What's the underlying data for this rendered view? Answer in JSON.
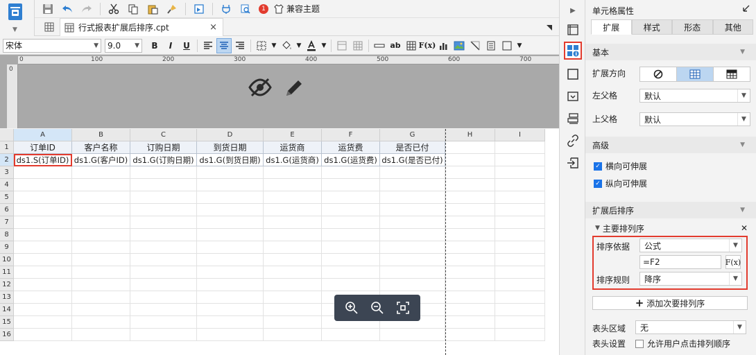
{
  "app": {
    "logo_icon": "report-logo-icon"
  },
  "toolbar": {
    "badge_count": "1",
    "compat_theme_label": "兼容主题"
  },
  "tab": {
    "title": "行式报表扩展后排序.cpt",
    "close": "×"
  },
  "format": {
    "font_family": "宋体",
    "font_size": "9.0",
    "bold": "B",
    "italic": "I",
    "underline": "U",
    "text_tool": "ab",
    "fx": "F(x)"
  },
  "ruler": {
    "ticks": [
      "0",
      "100",
      "200",
      "300",
      "400",
      "500",
      "600",
      "700"
    ]
  },
  "grid": {
    "columns": [
      "A",
      "B",
      "C",
      "D",
      "E",
      "F",
      "G",
      "H",
      "I"
    ],
    "rows": [
      "1",
      "2",
      "3",
      "4",
      "5",
      "6",
      "7",
      "8",
      "9",
      "10",
      "11",
      "12",
      "13",
      "14",
      "15",
      "16"
    ],
    "header_row": [
      "订单ID",
      "客户名称",
      "订购日期",
      "到货日期",
      "运货商",
      "运货费",
      "是否已付"
    ],
    "data_row": [
      "ds1.S(订单ID)",
      "ds1.G(客户ID)",
      "ds1.G(订购日期)",
      "ds1.G(到货日期)",
      "ds1.G(运货商)",
      "ds1.G(运货费)",
      "ds1.G(是否已付)"
    ]
  },
  "panel": {
    "title": "单元格属性",
    "tabs": [
      "扩展",
      "样式",
      "形态",
      "其他"
    ],
    "basic": {
      "section": "基本",
      "expand_direction_label": "扩展方向",
      "left_parent_label": "左父格",
      "left_parent_value": "默认",
      "top_parent_label": "上父格",
      "top_parent_value": "默认"
    },
    "advanced": {
      "section": "高级",
      "horizontal_expand": "横向可伸展",
      "vertical_expand": "纵向可伸展"
    },
    "sort": {
      "section": "扩展后排序",
      "primary_title": "主要排列序",
      "basis_label": "排序依据",
      "basis_value": "公式",
      "formula_value": "=F2",
      "fx_label": "F(x)",
      "rule_label": "排序规则",
      "rule_value": "降序",
      "add_secondary": "添加次要排列序"
    },
    "footer": {
      "header_area_label": "表头区域",
      "header_area_value": "无",
      "header_settings_label": "表头设置",
      "allow_click_sort": "允许用户点击排列顺序"
    }
  },
  "colors": {
    "accent_red": "#e23b2e",
    "selection_blue": "#bcd6f1",
    "zoom_bg": "#3c4553"
  }
}
